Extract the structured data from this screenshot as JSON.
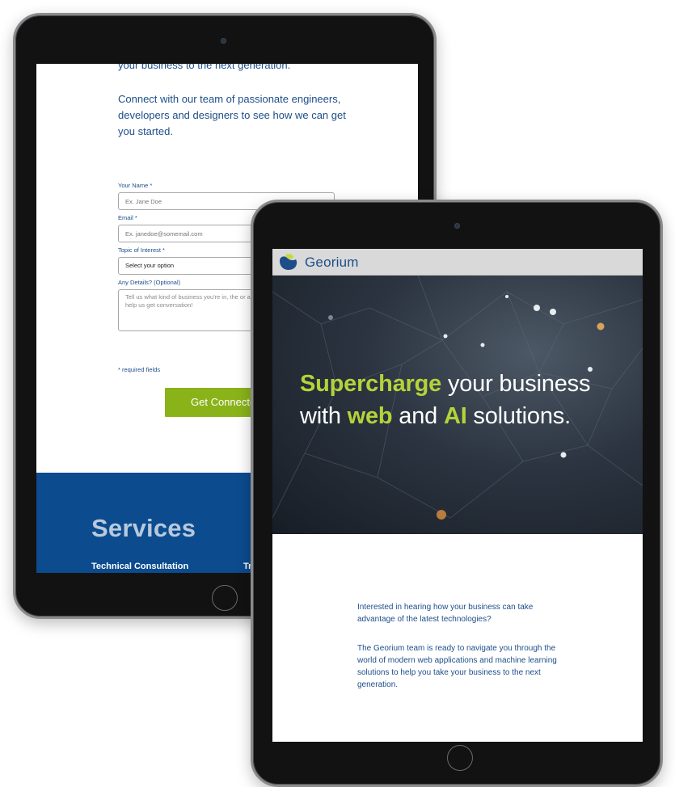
{
  "back_tablet": {
    "intro_top": "your business to the next generation.",
    "intro_connect": "Connect with our team of passionate engineers, developers and designers to see how we can get you started.",
    "form": {
      "name_label": "Your Name *",
      "name_placeholder": "Ex. Jane Doe",
      "email_label": "Email *",
      "email_placeholder": "Ex. janedoe@somemail.com",
      "topic_label": "Topic of Interest *",
      "topic_selected": "Select your option",
      "details_label": "Any Details? (Optional)",
      "details_placeholder": "Tell us what kind of business you're in, the or any other details that would help us get conversation!",
      "required_note": "* required fields",
      "submit_label": "Get Connecte"
    },
    "services": {
      "title": "Services",
      "item_1": "Technical Consultation",
      "item_2": "Tr"
    }
  },
  "front_tablet": {
    "brand": "Georium",
    "hero": {
      "w1": "Supercharge",
      "w2": " your business",
      "w3": "with ",
      "w4": "web",
      "w5": " and ",
      "w6": "AI",
      "w7": " solutions."
    },
    "body_copy_1": "Interested in hearing how your business can take advantage of the latest technologies?",
    "body_copy_2": "The Georium team is ready to navigate you through the world of modern web applications and machine learning solutions to help you take your business to the next generation."
  },
  "colors": {
    "brand_blue": "#1d4e89",
    "accent_green": "#b4d33a",
    "button_green": "#8ab31a",
    "services_blue": "#0c4b8e"
  },
  "icons": {
    "logo": "georium-logo-icon",
    "camera": "camera-icon",
    "home": "home-button-icon"
  }
}
